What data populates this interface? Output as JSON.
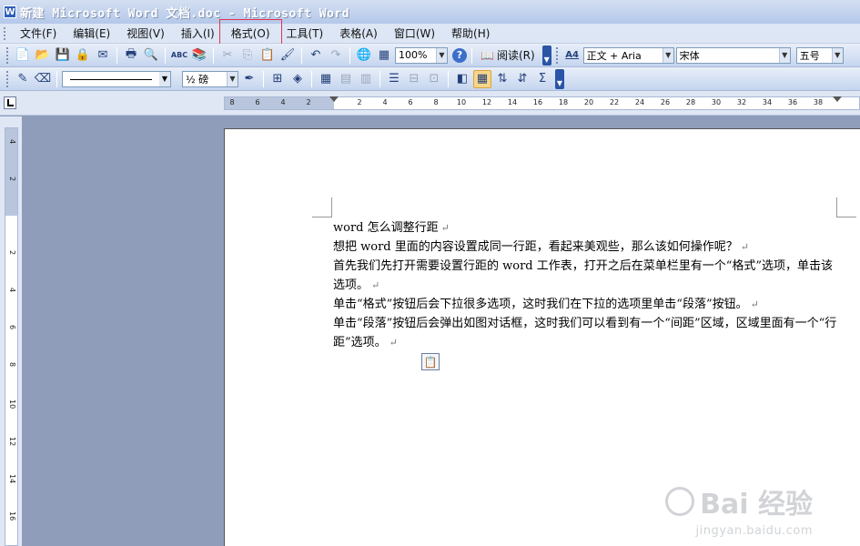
{
  "window": {
    "title": "新建 Microsoft Word 文档.doc - Microsoft Word",
    "app_icon": "W"
  },
  "menu": {
    "items": [
      {
        "label": "文件(F)",
        "id": "file"
      },
      {
        "label": "编辑(E)",
        "id": "edit"
      },
      {
        "label": "视图(V)",
        "id": "view"
      },
      {
        "label": "插入(I)",
        "id": "insert"
      },
      {
        "label": "格式(O)",
        "id": "format",
        "highlighted": true
      },
      {
        "label": "工具(T)",
        "id": "tools"
      },
      {
        "label": "表格(A)",
        "id": "table"
      },
      {
        "label": "窗口(W)",
        "id": "window"
      },
      {
        "label": "帮助(H)",
        "id": "help"
      }
    ]
  },
  "toolbar": {
    "zoom": "100%",
    "read_label": "阅读(R)",
    "style": "正文 + Aria",
    "font": "宋体",
    "size": "五号",
    "line_weight": "½ 磅",
    "icons": {
      "new": "📄",
      "open": "📂",
      "save": "💾",
      "permission": "🔒",
      "mail": "✉",
      "print": "🖶",
      "preview": "🔍",
      "spell": "ABC",
      "research": "📚",
      "cut": "✂",
      "copy": "⎘",
      "paste": "📋",
      "format_painter": "🖌",
      "undo": "↶",
      "redo": "↷",
      "hyperlink": "🌐",
      "tables": "▦",
      "help": "?",
      "style_icon": "A4"
    }
  },
  "ruler": {
    "h_ticks": [
      "8",
      "6",
      "4",
      "2",
      "2",
      "4",
      "6",
      "8",
      "10",
      "12",
      "14",
      "16",
      "18",
      "20",
      "22",
      "24",
      "26",
      "28",
      "30",
      "32",
      "34",
      "36",
      "38"
    ],
    "v_ticks": [
      "4",
      "2",
      "2",
      "4",
      "6",
      "8",
      "10",
      "12",
      "14",
      "16"
    ]
  },
  "document": {
    "paragraphs": [
      "word 怎么调整行距",
      "想把 word 里面的内容设置成同一行距，看起来美观些，那么该如何操作呢？",
      "首先我们先打开需要设置行距的 word 工作表，打开之后在菜单栏里有一个“格式”选项，单击该选项。",
      "单击“格式”按钮后会下拉很多选项，这时我们在下拉的选项里单击“段落”按钮。",
      "单击“段落”按钮后会弹出如图对话框，这时我们可以看到有一个“间距”区域，区域里面有一个“行距”选项。"
    ],
    "para_mark": "↵",
    "paste_icon": "📋"
  },
  "watermark": {
    "brand": "Bai 经验",
    "sub": "jingyan.baidu.com"
  }
}
